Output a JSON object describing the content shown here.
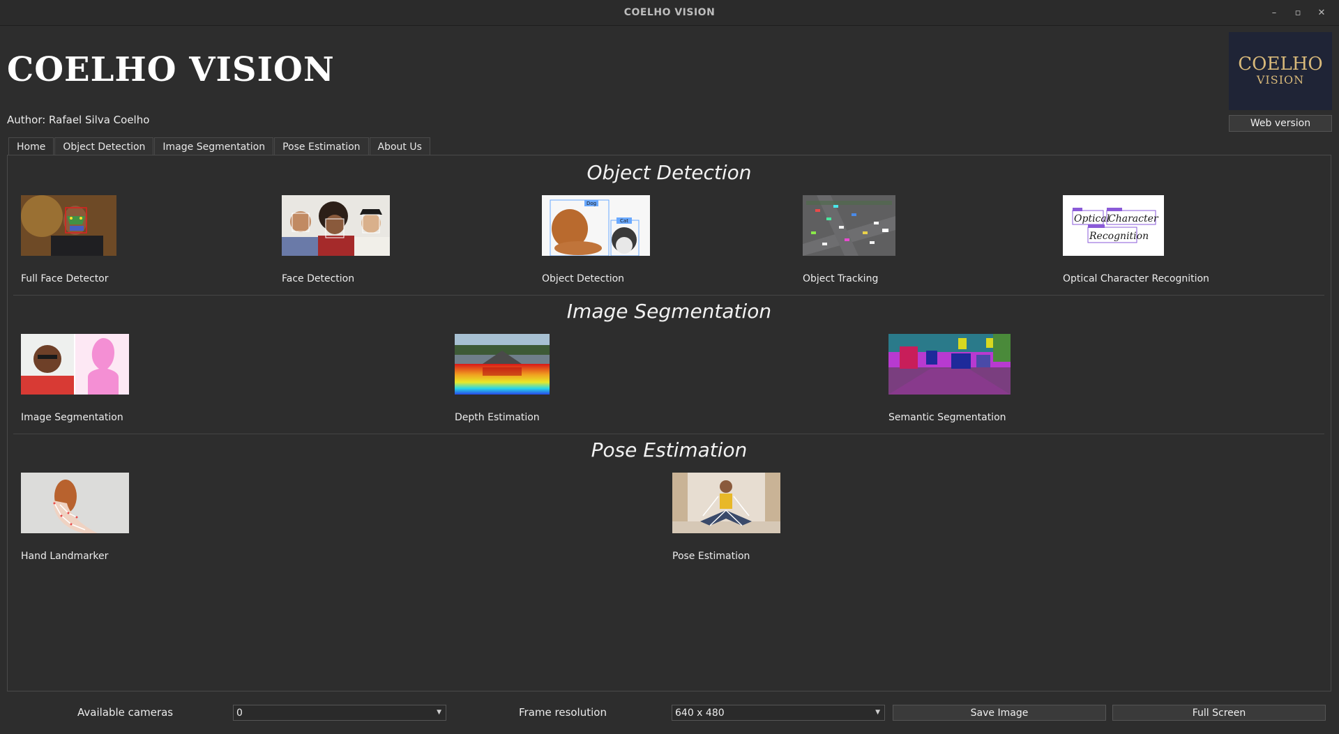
{
  "window": {
    "title": "COELHO VISION",
    "controls": [
      "minimize-icon",
      "restore-icon",
      "close-icon"
    ]
  },
  "header": {
    "heading": "COELHO VISION",
    "author": "Author: Rafael Silva Coelho",
    "logo_line1": "COELHO",
    "logo_line2": "VISION",
    "web_button": "Web version"
  },
  "tabs": [
    {
      "label": "Home",
      "active": true
    },
    {
      "label": "Object Detection",
      "active": false
    },
    {
      "label": "Image Segmentation",
      "active": false
    },
    {
      "label": "Pose Estimation",
      "active": false
    },
    {
      "label": "About Us",
      "active": false
    }
  ],
  "sections": [
    {
      "title": "Object Detection",
      "items": [
        {
          "label": "Full Face Detector"
        },
        {
          "label": "Face Detection"
        },
        {
          "label": "Object Detection",
          "tags": [
            "Dog",
            "Cat"
          ]
        },
        {
          "label": "Object Tracking"
        },
        {
          "label": "Optical Character Recognition",
          "thumb_text": [
            "Optical",
            "Character",
            "Recognition"
          ]
        }
      ]
    },
    {
      "title": "Image Segmentation",
      "items": [
        {
          "label": "Image Segmentation"
        },
        {
          "label": "Depth Estimation"
        },
        {
          "label": "Semantic Segmentation"
        }
      ]
    },
    {
      "title": "Pose Estimation",
      "items": [
        {
          "label": "Hand Landmarker"
        },
        {
          "label": "Pose Estimation"
        }
      ]
    }
  ],
  "footer": {
    "cameras_label": "Available cameras",
    "camera_value": "0",
    "resolution_label": "Frame resolution",
    "resolution_value": "640 x 480",
    "save_button": "Save Image",
    "fullscreen_button": "Full Screen"
  },
  "colors": {
    "background": "#2d2d2d",
    "logo_bg": "#1f2436",
    "logo_text": "#d8b97a"
  }
}
